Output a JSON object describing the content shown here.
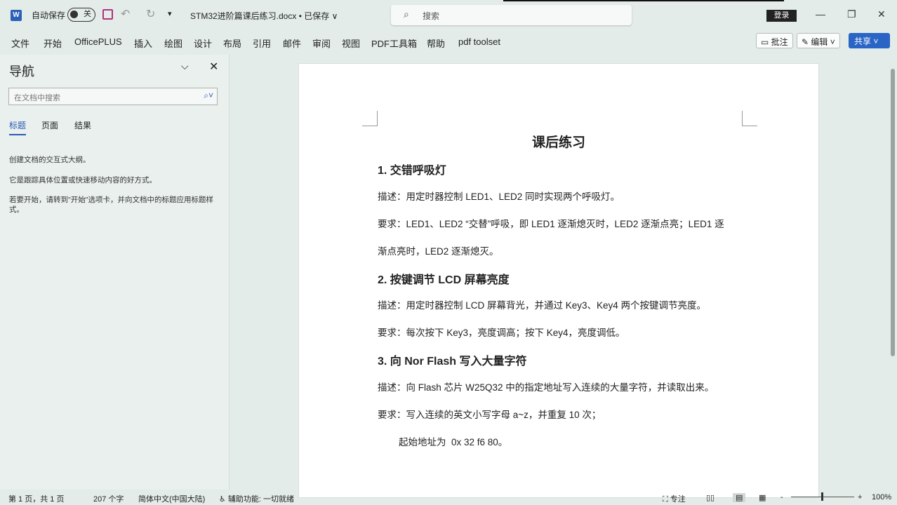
{
  "titlebar": {
    "app_icon": "W",
    "autosave_label": "自动保存",
    "autosave_state": "关",
    "qa_more": "▾",
    "doc_title": "STM32进阶篇课后练习.docx • 已保存 ∨",
    "search_placeholder": "搜索",
    "login": "登录"
  },
  "menu": [
    "文件",
    "开始",
    "OfficePLUS",
    "插入",
    "绘图",
    "设计",
    "布局",
    "引用",
    "邮件",
    "审阅",
    "视图",
    "PDF工具箱",
    "帮助",
    "pdf toolset"
  ],
  "ribbon_buttons": {
    "comment": "批注",
    "edit": "编辑",
    "share": "共享"
  },
  "nav": {
    "title": "导航",
    "search_placeholder": "在文档中搜索",
    "tabs": [
      "标题",
      "页面",
      "结果"
    ],
    "texts": [
      "创建文档的交互式大纲。",
      "它是跟踪具体位置或快速移动内容的好方式。",
      "若要开始，请转到\"开始\"选项卡，并向文档中的标题应用标题样式。"
    ]
  },
  "document": {
    "title": "课后练习",
    "lines": [
      {
        "type": "h",
        "text": "1.  交错呼吸灯"
      },
      {
        "type": "p",
        "text": "描述：用定时器控制 LED1、LED2 同时实现两个呼吸灯。"
      },
      {
        "type": "p",
        "text": "要求：LED1、LED2 “交替”呼吸，即 LED1 逐渐熄灭时，LED2 逐渐点亮；LED1 逐"
      },
      {
        "type": "p",
        "text": "渐点亮时，LED2 逐渐熄灭。"
      },
      {
        "type": "h",
        "text": "2.  按键调节 LCD 屏幕亮度"
      },
      {
        "type": "p",
        "text": "描述：用定时器控制 LCD 屏幕背光，并通过 Key3、Key4 两个按键调节亮度。"
      },
      {
        "type": "p",
        "text": "要求：每次按下  Key3，亮度调高；按下 Key4，亮度调低。"
      },
      {
        "type": "h",
        "text": "3.  向  Nor Flash  写入大量字符"
      },
      {
        "type": "p",
        "text": "描述：向  Flash  芯片 W25Q32  中的指定地址写入连续的大量字符，并读取出来。"
      },
      {
        "type": "p",
        "text": "要求：写入连续的英文小写字母 a~z，并重复  10  次；"
      },
      {
        "type": "p",
        "text": "        起始地址为  0x 32 f6 80。"
      }
    ]
  },
  "status": {
    "page": "第 1 页，共 1 页",
    "words": "207 个字",
    "language": "简体中文(中国大陆)",
    "accessibility": "辅助功能: 一切就绪",
    "focus": "专注",
    "zoom": "100%"
  }
}
